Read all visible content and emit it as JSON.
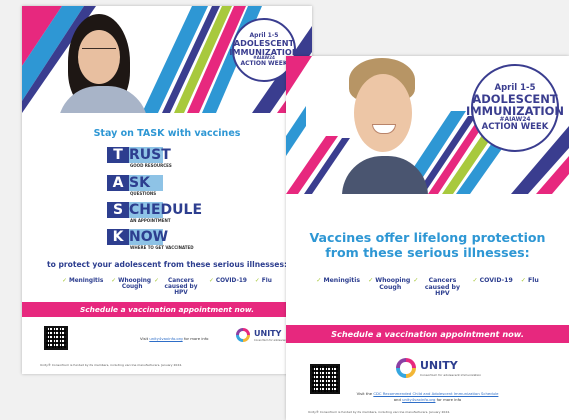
{
  "badge": {
    "date": "April 1-5",
    "line1": "ADOLESCENT",
    "line2": "IMMUNIZATION",
    "hashtag": "#AIAW24",
    "line3": "ACTION WEEK"
  },
  "poster_a": {
    "heading": "Stay on TASK with vaccines",
    "task": [
      {
        "letter": "T",
        "rest": "RUST",
        "sub": "GOOD RESOURCES"
      },
      {
        "letter": "A",
        "rest": "SK",
        "sub": "QUESTIONS"
      },
      {
        "letter": "S",
        "rest": "CHEDULE",
        "sub": "AN APPOINTMENT"
      },
      {
        "letter": "K",
        "rest": "NOW",
        "sub": "WHERE TO GET VACCINATED"
      }
    ],
    "protect_text": "to protect your adolescent from these serious illnesses:",
    "illnesses": [
      "Meningitis",
      "Whooping Cough",
      "Cancers caused by HPV",
      "COVID-19",
      "Flu"
    ],
    "cta": "Schedule a vaccination appointment now.",
    "visit_prefix": "Visit ",
    "visit_link": "unity4vaxinfo.org",
    "visit_suffix": " for more info",
    "logo": "UNITY",
    "logo_sub": "Consortium for adolescent immunization",
    "fine_print": "Unity® Consortium is funded by its members, including vaccine manufacturers. January 2024."
  },
  "poster_b": {
    "heading_line1": "Vaccines offer lifelong protection",
    "heading_line2": "from these serious illnesses:",
    "illnesses": [
      "Meningitis",
      "Whooping Cough",
      "Cancers caused by HPV",
      "COVID-19",
      "Flu"
    ],
    "cta": "Schedule a vaccination appointment now.",
    "logo": "UNITY",
    "logo_sub": "Consortium for adolescent immunization",
    "visit_prefix": "Visit the ",
    "visit_link": "CDC Recommended Child and Adolescent Immunization Schedule",
    "visit_line2_prefix": "and ",
    "visit_link2": "unity4vaxinfo.org",
    "visit_suffix": " for more info",
    "fine_print": "Unity® Consortium is funded by its members, including vaccine manufacturers. January 2024."
  },
  "colors": {
    "navy": "#2d3e8f",
    "sky": "#2e97d4",
    "pink": "#e7287e",
    "lime": "#a8c93d",
    "light_blue": "#8ec3e6"
  }
}
